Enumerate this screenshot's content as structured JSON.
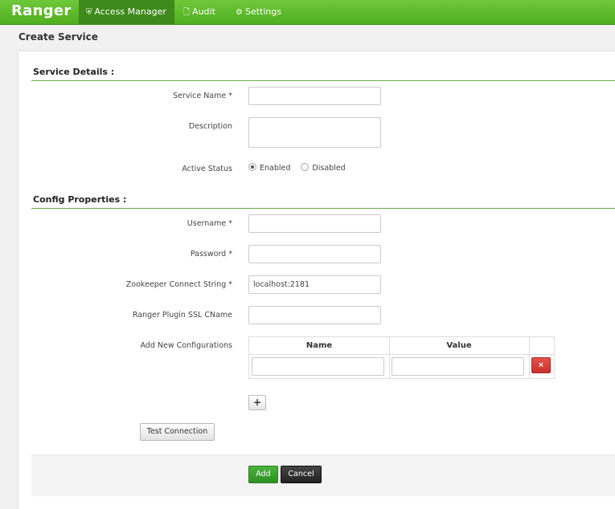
{
  "nav": {
    "brand": "Ranger",
    "items": [
      {
        "label": "Access Manager",
        "icon": "shield-icon",
        "active": true
      },
      {
        "label": "Audit",
        "icon": "document-icon",
        "active": false
      },
      {
        "label": "Settings",
        "icon": "gear-icon",
        "active": false
      }
    ]
  },
  "page": {
    "title": "Create Service"
  },
  "service_details": {
    "heading": "Service Details :",
    "service_name_label": "Service Name *",
    "service_name_value": "",
    "description_label": "Description",
    "description_value": "",
    "active_status_label": "Active Status",
    "status_options": [
      "Enabled",
      "Disabled"
    ],
    "status_selected": "Enabled"
  },
  "config_properties": {
    "heading": "Config Properties :",
    "username_label": "Username *",
    "username_value": "",
    "password_label": "Password *",
    "password_value": "",
    "zookeeper_label": "Zookeeper Connect String *",
    "zookeeper_value": "localhost:2181",
    "ssl_cname_label": "Ranger Plugin SSL CName",
    "ssl_cname_value": "",
    "add_new_label": "Add New Configurations",
    "table_headers": [
      "Name",
      "Value"
    ],
    "delete_symbol": "×",
    "add_row_symbol": "+"
  },
  "actions": {
    "test_connection": "Test Connection",
    "add": "Add",
    "cancel": "Cancel"
  },
  "colors": {
    "nav_green": "#4fae1f",
    "nav_active": "#3e8a1a",
    "section_line": "#6aa84f",
    "add_button": "#2f8f24",
    "delete_button": "#c9302c",
    "cancel_button": "#222222"
  }
}
